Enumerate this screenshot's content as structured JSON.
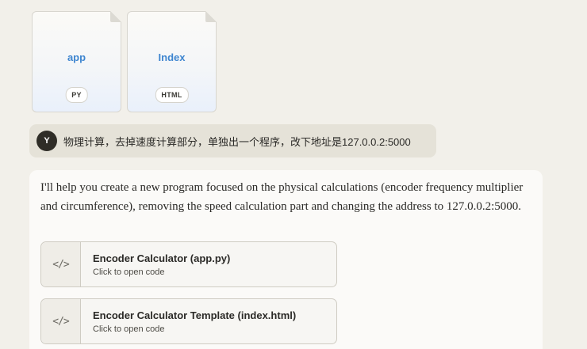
{
  "attachments": [
    {
      "name": "app",
      "ext": "PY"
    },
    {
      "name": "Index",
      "ext": "HTML"
    }
  ],
  "user_message": {
    "avatar_initial": "Y",
    "text": "物理计算，去掉速度计算部分，单独出一个程序，改下地址是127.0.0.2:5000"
  },
  "assistant_message": {
    "text": "I'll help you create a new program focused on the physical calculations (encoder frequency multiplier and circumference), removing the speed calculation part and changing the address to 127.0.0.2:5000.",
    "artifacts": [
      {
        "icon": "code-icon",
        "title": "Encoder Calculator (app.py)",
        "subtitle": "Click to open code"
      },
      {
        "icon": "code-icon",
        "title": "Encoder Calculator Template (index.html)",
        "subtitle": "Click to open code"
      }
    ]
  },
  "colors": {
    "background": "#f2f0ea",
    "file_name": "#3f86d0",
    "user_bubble": "#e5e2d8",
    "avatar": "#2f2d27",
    "assistant_bubble": "#fbfaf8"
  }
}
